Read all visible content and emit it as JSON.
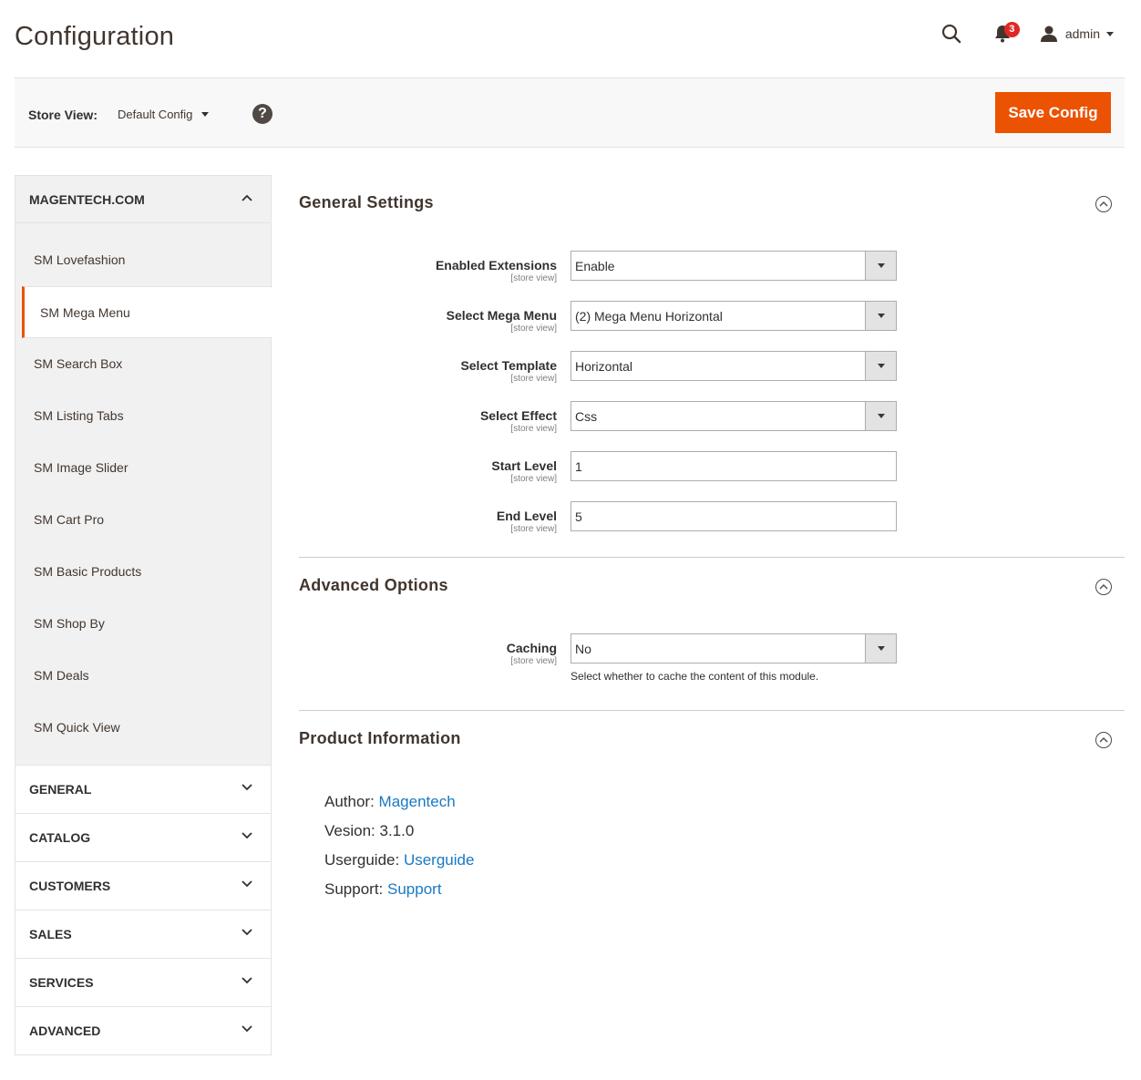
{
  "header": {
    "title": "Configuration",
    "notification_count": "3",
    "user_name": "admin"
  },
  "store_bar": {
    "label": "Store View:",
    "selected": "Default Config",
    "help_glyph": "?",
    "save_label": "Save Config"
  },
  "sidebar": {
    "open_tab": "MAGENTECH.COM",
    "items": [
      "SM Lovefashion",
      "SM Mega Menu",
      "SM Search Box",
      "SM Listing Tabs",
      "SM Image Slider",
      "SM Cart Pro",
      "SM Basic Products",
      "SM Shop By",
      "SM Deals",
      "SM Quick View"
    ],
    "active_item": "SM Mega Menu",
    "tabs": [
      "GENERAL",
      "CATALOG",
      "CUSTOMERS",
      "SALES",
      "SERVICES",
      "ADVANCED"
    ]
  },
  "general": {
    "title": "General Settings",
    "scope": "[store view]",
    "fields": [
      {
        "label": "Enabled Extensions",
        "value": "Enable"
      },
      {
        "label": "Select Mega Menu",
        "value": "(2) Mega Menu Horizontal"
      },
      {
        "label": "Select Template",
        "value": "Horizontal"
      },
      {
        "label": "Select Effect",
        "value": "Css"
      },
      {
        "label": "Start Level",
        "value": "1"
      },
      {
        "label": "End Level",
        "value": "5"
      }
    ]
  },
  "advanced": {
    "title": "Advanced Options",
    "caching_label": "Caching",
    "caching_value": "No",
    "caching_note": "Select whether to cache the content of this module."
  },
  "product_info": {
    "title": "Product Information",
    "author_label": "Author: ",
    "author_link": "Magentech",
    "version_label": "Vesion: 3.1.0",
    "userguide_label": "Userguide: ",
    "userguide_link": "Userguide",
    "support_label": "Support: ",
    "support_link": "Support"
  },
  "colors": {
    "accent": "#eb5202",
    "link": "#1979c3",
    "badge": "#e22626"
  }
}
